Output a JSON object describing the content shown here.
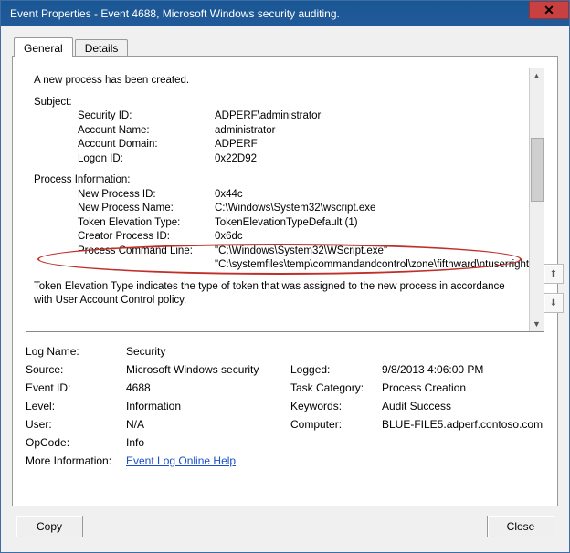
{
  "window": {
    "title": "Event Properties - Event 4688, Microsoft Windows security auditing."
  },
  "tabs": {
    "general": "General",
    "details": "Details"
  },
  "content": {
    "heading": "A new process has been created.",
    "subject_label": "Subject:",
    "subject": {
      "security_id_label": "Security ID:",
      "security_id_value": "ADPERF\\administrator",
      "account_name_label": "Account Name:",
      "account_name_value": "administrator",
      "account_domain_label": "Account Domain:",
      "account_domain_value": "ADPERF",
      "logon_id_label": "Logon ID:",
      "logon_id_value": "0x22D92"
    },
    "process_info_label": "Process Information:",
    "process": {
      "new_pid_label": "New Process ID:",
      "new_pid_value": "0x44c",
      "new_pname_label": "New Process Name:",
      "new_pname_value": "C:\\Windows\\System32\\wscript.exe",
      "tet_label": "Token Elevation Type:",
      "tet_value": "TokenElevationTypeDefault (1)",
      "creator_label": "Creator Process ID:",
      "creator_value": "0x6dc",
      "cmd_label": "Process Command Line:",
      "cmd_value": "\"C:\\Windows\\System32\\WScript.exe\" \"C:\\systemfiles\\temp\\commandandcontrol\\zone\\fifthward\\ntuserrights.vbs\""
    },
    "explain": "Token Elevation Type indicates the type of token that was assigned to the new process in accordance with User Account Control policy."
  },
  "meta": {
    "log_name_label": "Log Name:",
    "log_name": "Security",
    "source_label": "Source:",
    "source": "Microsoft Windows security",
    "logged_label": "Logged:",
    "logged": "9/8/2013 4:06:00 PM",
    "event_id_label": "Event ID:",
    "event_id": "4688",
    "task_cat_label": "Task Category:",
    "task_cat": "Process Creation",
    "level_label": "Level:",
    "level": "Information",
    "keywords_label": "Keywords:",
    "keywords": "Audit Success",
    "user_label": "User:",
    "user": "N/A",
    "computer_label": "Computer:",
    "computer": "BLUE-FILE5.adperf.contoso.com",
    "opcode_label": "OpCode:",
    "opcode": "Info",
    "more_info_label": "More Information:",
    "more_info_link": "Event Log Online Help"
  },
  "buttons": {
    "copy": "Copy",
    "close": "Close"
  }
}
